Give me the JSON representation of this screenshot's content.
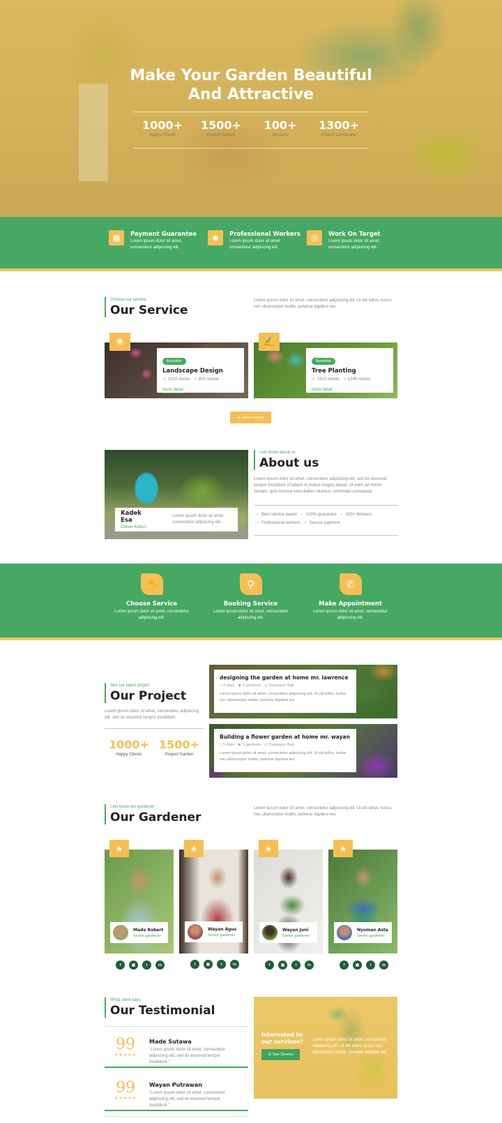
{
  "hero": {
    "title_line1": "Make Your Garden Beautiful",
    "title_line2": "And Attractive",
    "stats": [
      {
        "value": "1000+",
        "label": "Happy Clients"
      },
      {
        "value": "1500+",
        "label": "Project Garden"
      },
      {
        "value": "100+",
        "label": "Workers"
      },
      {
        "value": "1300+",
        "label": "Project Landscape"
      }
    ]
  },
  "features": [
    {
      "icon": "payment-icon",
      "title": "Payment Guarantee",
      "desc": "Lorem ipsum dolor sit amet, consectetur adipiscing elit."
    },
    {
      "icon": "workers-icon",
      "title": "Professional Workers",
      "desc": "Lorem ipsum dolor sit amet, consectetur adipiscing elit."
    },
    {
      "icon": "target-icon",
      "title": "Work On Target",
      "desc": "Lorem ipsum dolor sit amet, consectetur adipiscing elit."
    }
  ],
  "service": {
    "kicker": "Choose our service",
    "title": "Our Service",
    "desc": "Lorem ipsum dolor sit amet, consectetur adipiscing elit. Ut elit tellus, luctus nec ullamcorper mattis, pulvinar dapibus leo.",
    "cards": [
      {
        "badge": "Bestseller",
        "title": "Landscape Design",
        "clients": "1203 clients",
        "reviews": "800 review",
        "link": "more detail"
      },
      {
        "badge": "Bestseller",
        "title": "Tree Planting",
        "clients": "1432 clients",
        "reviews": "1245 review",
        "link": "more detail"
      }
    ],
    "other_button": "other service"
  },
  "about": {
    "kicker": "Lets know about us",
    "title": "About us",
    "desc": "Lorem ipsum dolor sit amet, consectetur adipiscing elit, sed do eiusmod tempor incididunt ut labore et dolore magna aliqua. Ut enim ad minim veniam, quis nostrud exercitation ullamco. commodo consequat.",
    "person_name": "Kadek Esa",
    "person_role": "Owner Kebun",
    "person_desc": "Lorem ipsum dolor sit amet, consectetur adipiscing elit.",
    "checks_row1": [
      "Best service award",
      "100% guarantee",
      "100+ Workers"
    ],
    "checks_row2": [
      "Professional workers",
      "Secure payment"
    ]
  },
  "process": [
    {
      "title": "Choose Service",
      "desc": "Lorem ipsum dolor sit amet, consectetur adipiscing elit."
    },
    {
      "title": "Booking Service",
      "desc": "Lorem ipsum dolor sit amet, consectetur adipiscing elit."
    },
    {
      "title": "Make Appointment",
      "desc": "Lorem ipsum dolor sit amet, consectetur adipiscing elit."
    }
  ],
  "project": {
    "kicker": "See our latest project",
    "title": "Our Project",
    "desc": "Lorem ipsum dolor sit amet, consectetur adipiscing elit, sed do eiusmod tempor incididunt.",
    "stats": [
      {
        "value": "1000+",
        "label": "Happy Clients"
      },
      {
        "value": "1500+",
        "label": "Project Garden"
      }
    ],
    "items": [
      {
        "title": "designing the garden at home mr. lawrence",
        "days": "4 days",
        "gardener": "3 gardener",
        "location": "Denpasar, Bali",
        "desc": "Lorem ipsum dolor sit amet, consectetur adipiscing elit. Ut elit tellus, luctus nec ullamcorper mattis, pulvinar dapibus leo."
      },
      {
        "title": "Building a flower garden at home mr. wayan",
        "days": "5 days",
        "gardener": "3 gardener",
        "location": "Denpasar, Bali",
        "desc": "Lorem ipsum dolor sit amet, consectetur adipiscing elit. Ut elit tellus, luctus nec ullamcorper mattis, pulvinar dapibus leo."
      }
    ]
  },
  "gardener": {
    "kicker": "Lets know our gardener",
    "title": "Our Gardener",
    "desc": "Lorem ipsum dolor sit amet, consectetur adipiscing elit. Ut elit tellus, luctus nec ullamcorper mattis, pulvinar dapibus leo.",
    "people": [
      {
        "name": "Made Robert",
        "role": "Senior gardener"
      },
      {
        "name": "Wayan Agus",
        "role": "Senior gardener"
      },
      {
        "name": "Wayan Juni",
        "role": "Senior gardener"
      },
      {
        "name": "Nyoman Asta",
        "role": "Senior gardener"
      }
    ],
    "social": [
      "f",
      "ig",
      "tw",
      "in"
    ]
  },
  "testimonial": {
    "kicker": "What client says",
    "title": "Our Testimonial",
    "items": [
      {
        "name": "Made Sutawa",
        "quote": "\"Lorem ipsum dolor sit amet, consectetur adipiscing elit, sed do eiusmod tempor incididunt.\"",
        "stars": "★★★★★",
        "rating": 5
      },
      {
        "name": "Wayan Putrawan",
        "quote": "\"Lorem ipsum dolor sit amet, consectetur adipiscing elit, sed do eiusmod tempor incididunt.\"",
        "stars": "★★★★★",
        "rating": 5
      }
    ]
  },
  "cta": {
    "title": "Interested in our services?",
    "button": "See Service",
    "desc": "Lorem ipsum dolor sit amet, consectetur adipiscing elit. Ut elit tellus, luctus nec ullamcorper mattis, pulvinar dapibus leo."
  },
  "colors": {
    "green": "#46a862",
    "yellow": "#f5bf55",
    "dark_green": "#1f5e36"
  }
}
